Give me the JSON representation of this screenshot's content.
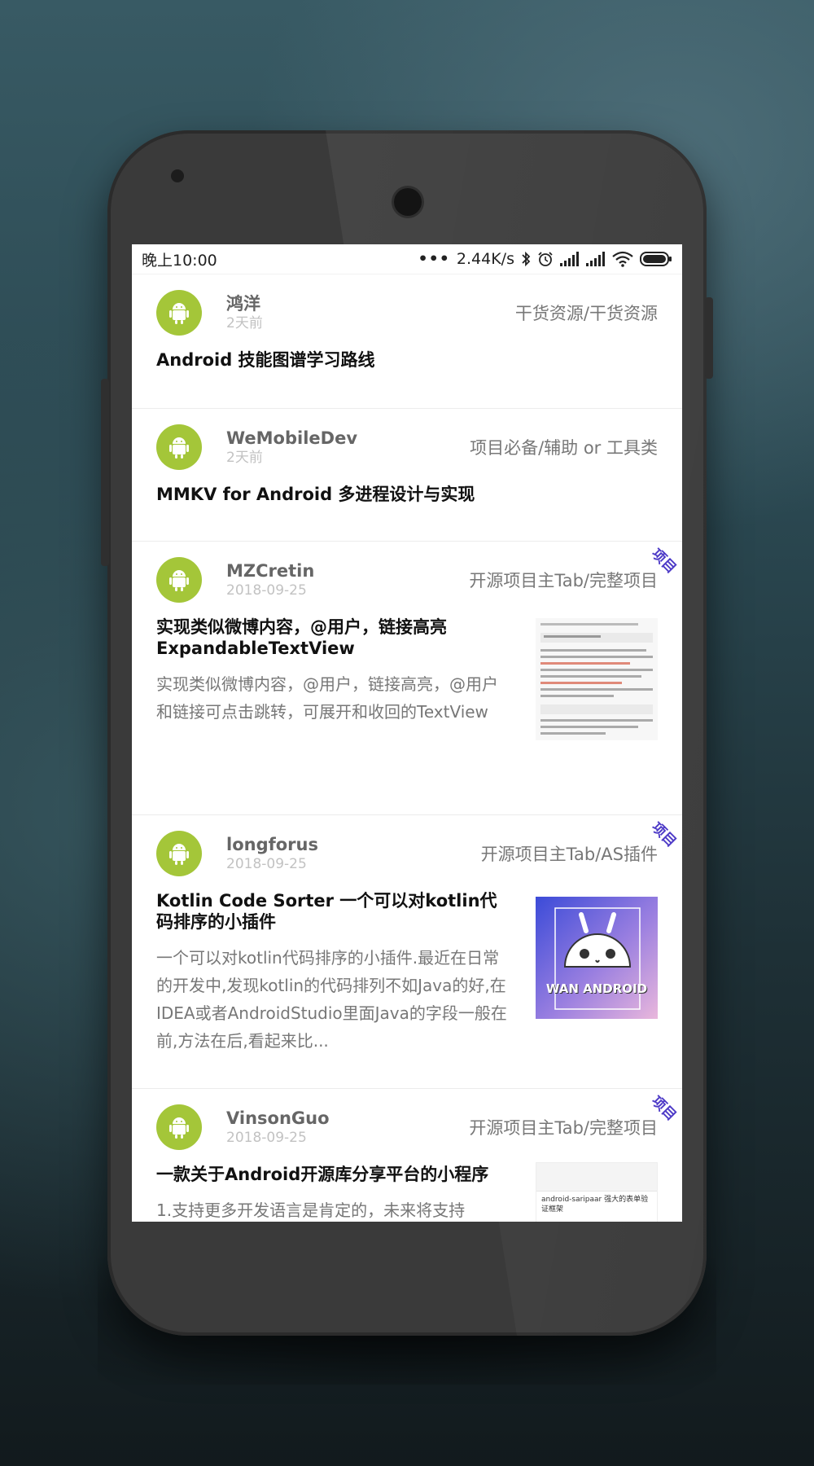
{
  "status_bar": {
    "time": "晚上10:00",
    "dots": "•••",
    "speed": "2.44K/s"
  },
  "accent": "#4d3ac7",
  "avatar_color": "#a4c639",
  "articles": [
    {
      "author": "鸿洋",
      "time": "2天前",
      "chapter": "干货资源/干货资源",
      "title": "Android 技能图谱学习路线",
      "desc": "",
      "tag": "",
      "thumbnail": ""
    },
    {
      "author": "WeMobileDev",
      "time": "2天前",
      "chapter": "项目必备/辅助 or 工具类",
      "title": "MMKV for Android 多进程设计与实现",
      "desc": "",
      "tag": "",
      "thumbnail": ""
    },
    {
      "author": "MZCretin",
      "time": "2018-09-25",
      "chapter": "开源项目主Tab/完整项目",
      "title": "实现类似微博内容，@用户，链接高亮ExpandableTextView",
      "desc": "实现类似微博内容，@用户，链接高亮，@用户和链接可点击跳转，可展开和收回的TextView",
      "tag": "项目",
      "thumbnail": "text-screenshot"
    },
    {
      "author": "longforus",
      "time": "2018-09-25",
      "chapter": "开源项目主Tab/AS插件",
      "title": "Kotlin Code Sorter 一个可以对kotlin代码排序的小插件",
      "desc": "  一个可以对kotlin代码排序的小插件.最近在日常的开发中,发现kotlin的代码排列不如Java的好,在IDEA或者AndroidStudio里面Java的字段一般在前,方法在后,看起来比...",
      "tag": "项目",
      "thumbnail": "wan-android-logo",
      "thumb_label": "WAN ANDROID"
    },
    {
      "author": "VinsonGuo",
      "time": "2018-09-25",
      "chapter": "开源项目主Tab/完整项目",
      "title": "一款关于Android开源库分享平台的小程序",
      "desc": "1.支持更多开发语言是肯定的，未来将支持",
      "tag": "项目",
      "thumbnail": "app-screenshot",
      "thumb_caption": "android-saripaar 强大的表单验证框架"
    }
  ]
}
